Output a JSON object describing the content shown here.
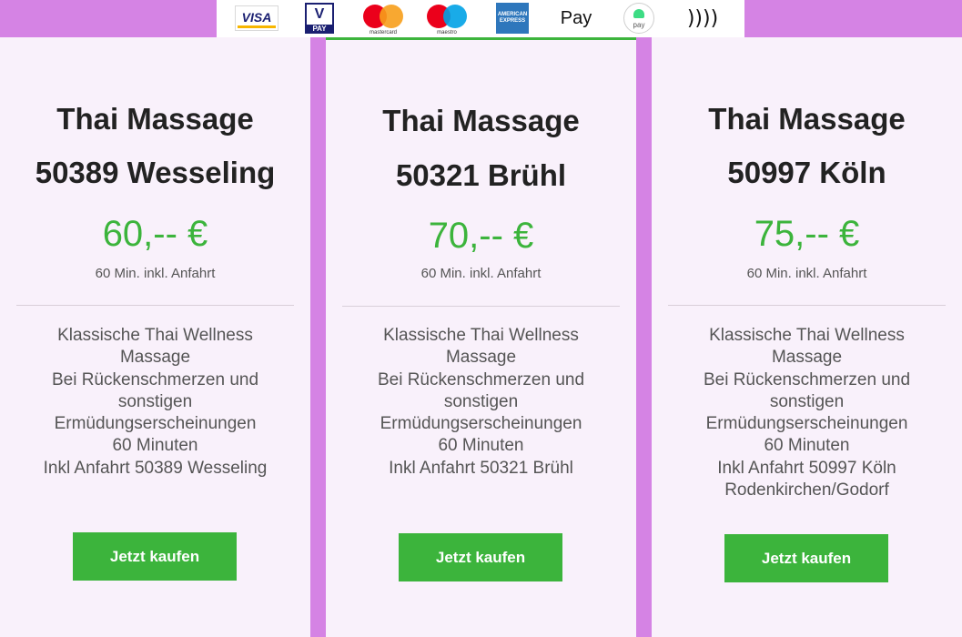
{
  "payment_methods": [
    {
      "name": "visa",
      "label": "VISA"
    },
    {
      "name": "vpay",
      "label": "V",
      "sublabel": "PAY"
    },
    {
      "name": "mastercard",
      "label": "mastercard"
    },
    {
      "name": "maestro",
      "label": "maestro"
    },
    {
      "name": "american-express",
      "label": "AMERICAN EXPRESS"
    },
    {
      "name": "apple-pay",
      "label": " Pay"
    },
    {
      "name": "android-pay",
      "label": "pay"
    },
    {
      "name": "contactless",
      "label": "))))"
    }
  ],
  "cards": [
    {
      "title": "Thai Massage",
      "location": "50389 Wesseling",
      "price": "60,-- €",
      "price_note": "60 Min. inkl. Anfahrt",
      "description_lines": [
        "Klassische Thai Wellness",
        "Massage",
        "Bei Rückenschmerzen und",
        "sonstigen",
        "Ermüdungserscheinungen",
        "60 Minuten",
        "Inkl Anfahrt 50389 Wesseling"
      ],
      "button": "Jetzt kaufen"
    },
    {
      "title": "Thai Massage",
      "location": "50321 Brühl",
      "price": "70,-- €",
      "price_note": "60 Min. inkl. Anfahrt",
      "description_lines": [
        "Klassische Thai Wellness",
        "Massage",
        "Bei Rückenschmerzen und",
        "sonstigen",
        "Ermüdungserscheinungen",
        "60 Minuten",
        "Inkl Anfahrt 50321 Brühl"
      ],
      "button": "Jetzt kaufen"
    },
    {
      "title": "Thai Massage",
      "location": "50997 Köln",
      "price": "75,-- €",
      "price_note": "60 Min. inkl. Anfahrt",
      "description_lines": [
        "Klassische Thai Wellness",
        "Massage",
        "Bei Rückenschmerzen und",
        "sonstigen",
        "Ermüdungserscheinungen",
        "60 Minuten",
        "Inkl Anfahrt 50997 Köln",
        "Rodenkirchen/Godorf"
      ],
      "button": "Jetzt kaufen"
    }
  ],
  "colors": {
    "accent": "#3cb43c",
    "page_background": "#d583e4",
    "card_background": "#f9f1fb"
  }
}
